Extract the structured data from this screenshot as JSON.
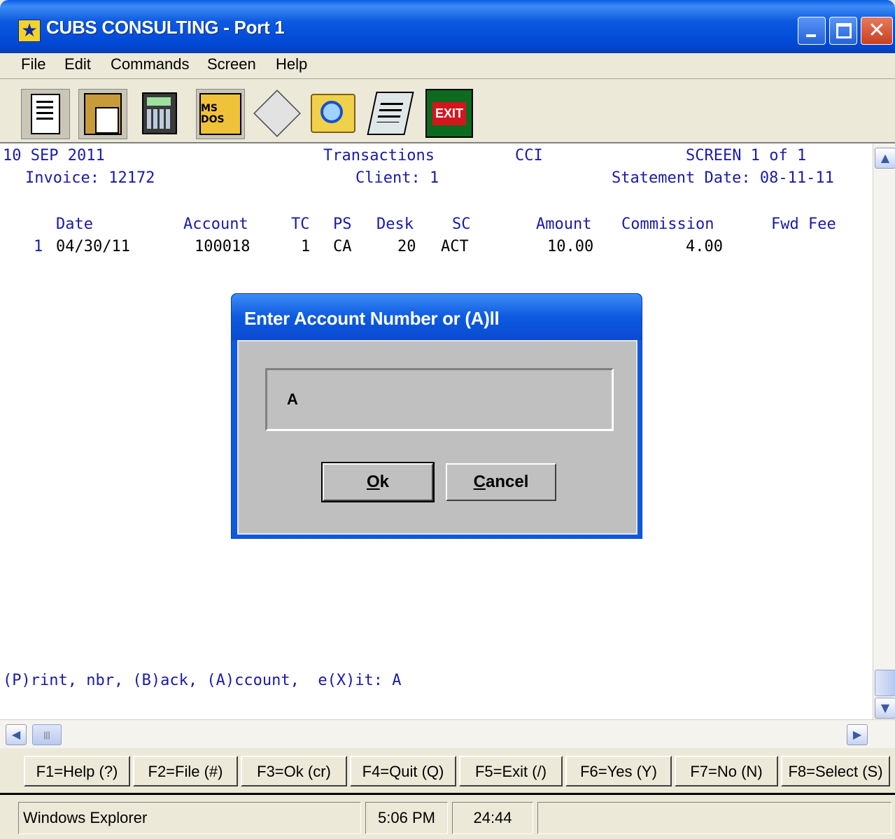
{
  "window": {
    "title": "CUBS CONSULTING - Port 1",
    "close_glyph": "✕"
  },
  "menu": {
    "items": [
      "File",
      "Edit",
      "Commands",
      "Screen",
      "Help"
    ]
  },
  "toolbar": {
    "msdos_label": "MS DOS",
    "exit_label": "EXIT",
    "icons": [
      "copy-icon",
      "paste-icon",
      "calculator-icon",
      "msdos-icon",
      "print-icon",
      "find-icon",
      "notepad-icon",
      "exit-icon"
    ]
  },
  "terminal": {
    "date": "10 SEP 2011",
    "screen_title": "Transactions",
    "company": "CCI",
    "screen_indicator": "SCREEN 1 of 1",
    "invoice": "Invoice: 12172",
    "client": "Client: 1",
    "statement_date": "Statement Date: 08-11-11",
    "columns": [
      "Date",
      "Account",
      "TC",
      "PS",
      "Desk",
      "SC",
      "Amount",
      "Commission",
      "Fwd Fee"
    ],
    "rows": [
      {
        "num": "1",
        "date": "04/30/11",
        "account": "100018",
        "tc": "1",
        "ps": "CA",
        "desk": "20",
        "sc": "ACT",
        "amount": "10.00",
        "commission": "4.00",
        "fwd_fee": ""
      }
    ],
    "prompt": "(P)rint, nbr, (B)ack, (A)ccount,  e(X)it: A"
  },
  "dialog": {
    "title": "Enter Account Number or (A)ll",
    "input_value": "A",
    "ok_mnemonic": "O",
    "ok_rest": "k",
    "cancel_mnemonic": "C",
    "cancel_rest": "ancel"
  },
  "fkeys": [
    "F1=Help (?)",
    "F2=File (#)",
    "F3=Ok (cr)",
    "F4=Quit (Q)",
    "F5=Exit (/)",
    "F6=Yes (Y)",
    "F7=No (N)",
    "F8=Select (S)"
  ],
  "statusbar": {
    "app": "Windows Explorer",
    "time": "5:06 PM",
    "elapsed": "24:44"
  },
  "colors": {
    "title_blue": "#0d5ae0",
    "terminal_text": "#1a1aaa",
    "chrome": "#ece9d8"
  }
}
